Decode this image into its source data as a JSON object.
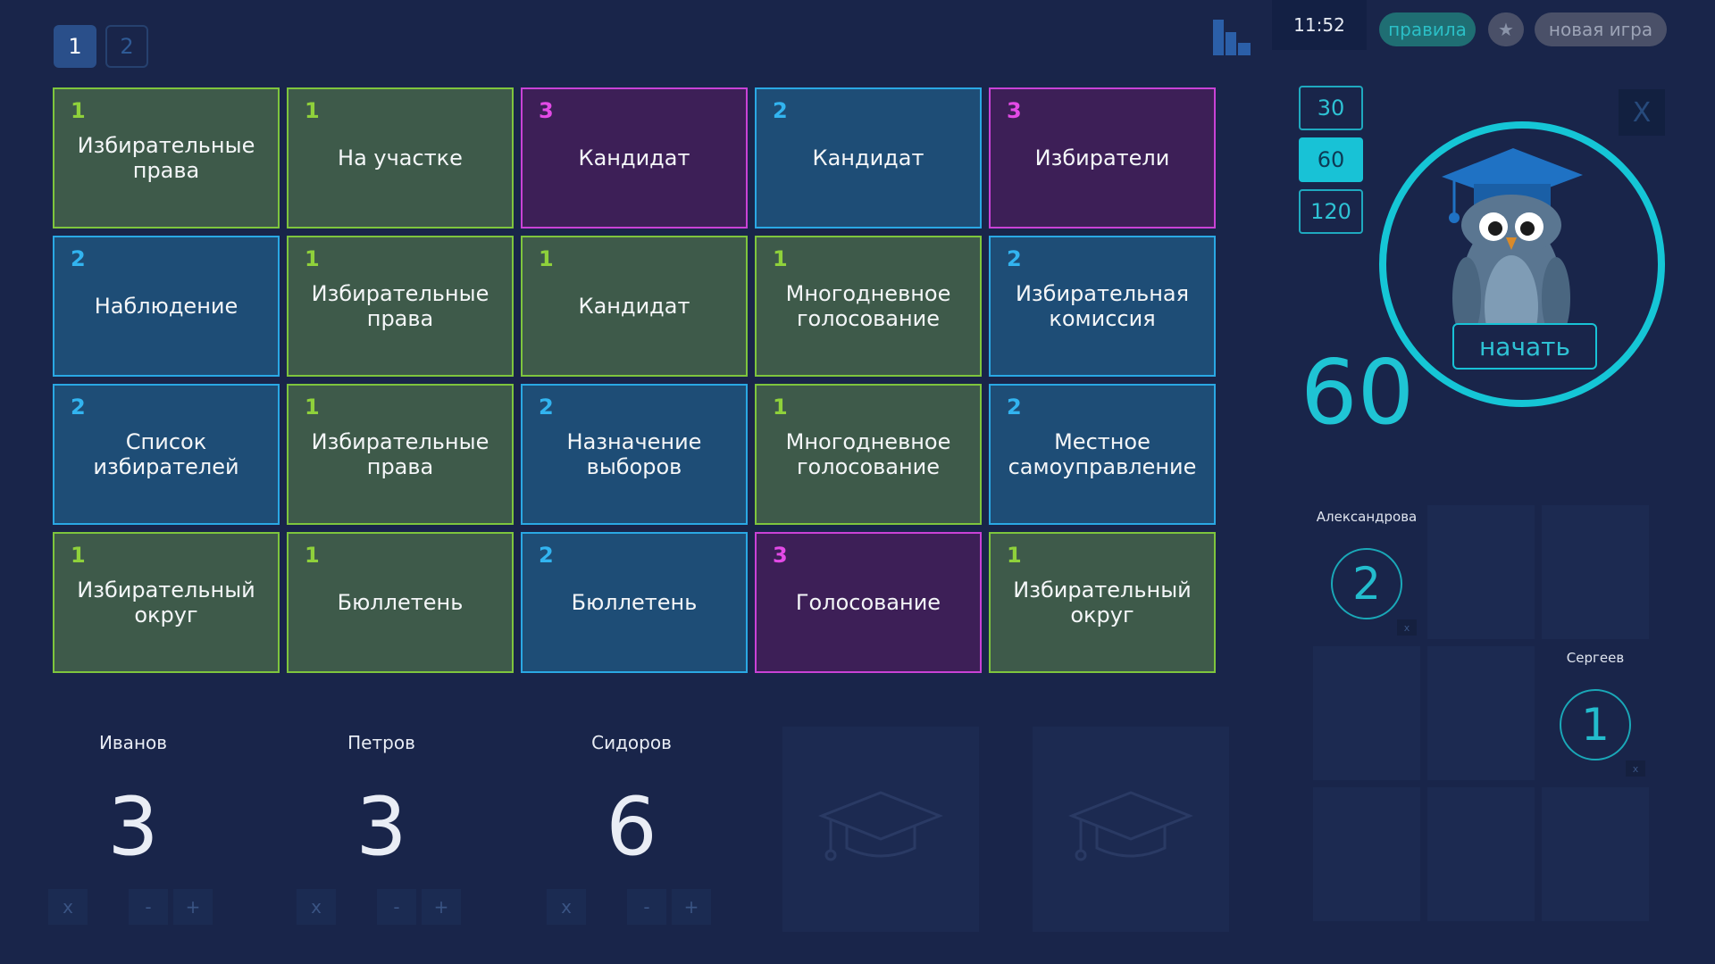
{
  "page_tabs": [
    {
      "label": "1",
      "active": true
    },
    {
      "label": "2",
      "active": false
    }
  ],
  "board": {
    "rows": [
      [
        {
          "points": "1",
          "label": "Избирательные права",
          "color": "green"
        },
        {
          "points": "1",
          "label": "На участке",
          "color": "green"
        },
        {
          "points": "3",
          "label": "Кандидат",
          "color": "purple"
        },
        {
          "points": "2",
          "label": "Кандидат",
          "color": "blue"
        },
        {
          "points": "3",
          "label": "Избиратели",
          "color": "purple"
        }
      ],
      [
        {
          "points": "2",
          "label": "Наблюдение",
          "color": "blue"
        },
        {
          "points": "1",
          "label": "Избирательные права",
          "color": "green"
        },
        {
          "points": "1",
          "label": "Кандидат",
          "color": "green"
        },
        {
          "points": "1",
          "label": "Многодневное голосование",
          "color": "green"
        },
        {
          "points": "2",
          "label": "Избирательная комиссия",
          "color": "blue"
        }
      ],
      [
        {
          "points": "2",
          "label": "Список избирателей",
          "color": "blue"
        },
        {
          "points": "1",
          "label": "Избирательные права",
          "color": "green"
        },
        {
          "points": "2",
          "label": "Назначение выборов",
          "color": "blue"
        },
        {
          "points": "1",
          "label": "Многодневное голосование",
          "color": "green"
        },
        {
          "points": "2",
          "label": "Местное самоуправление",
          "color": "blue"
        }
      ],
      [
        {
          "points": "1",
          "label": "Избирательный округ",
          "color": "green"
        },
        {
          "points": "1",
          "label": "Бюллетень",
          "color": "green"
        },
        {
          "points": "2",
          "label": "Бюллетень",
          "color": "blue"
        },
        {
          "points": "3",
          "label": "Голосование",
          "color": "purple"
        },
        {
          "points": "1",
          "label": "Избирательный округ",
          "color": "green"
        }
      ]
    ]
  },
  "header": {
    "clock": "11:52",
    "rules_label": "правила",
    "star_label": "★",
    "new_game_label": "новая игра"
  },
  "timer": {
    "options": [
      "30",
      "60",
      "120"
    ],
    "selected": "60",
    "value": "60",
    "start_label": "начать",
    "close_label": "X"
  },
  "players": [
    {
      "name": "Иванов",
      "score": "3"
    },
    {
      "name": "Петров",
      "score": "3"
    },
    {
      "name": "Сидоров",
      "score": "6"
    }
  ],
  "player_controls": {
    "remove": "x",
    "minus": "-",
    "plus": "+"
  },
  "teams": [
    {
      "name": "Александрова",
      "score": "2"
    },
    {
      "name": "Сергеев",
      "score": "1"
    }
  ],
  "team_remove": "x",
  "colors": {
    "background": "#19254a",
    "green_border": "#7ec53d",
    "blue_border": "#2aa8e4",
    "purple_border": "#c942d6",
    "accent_cyan": "#15c6d6"
  }
}
